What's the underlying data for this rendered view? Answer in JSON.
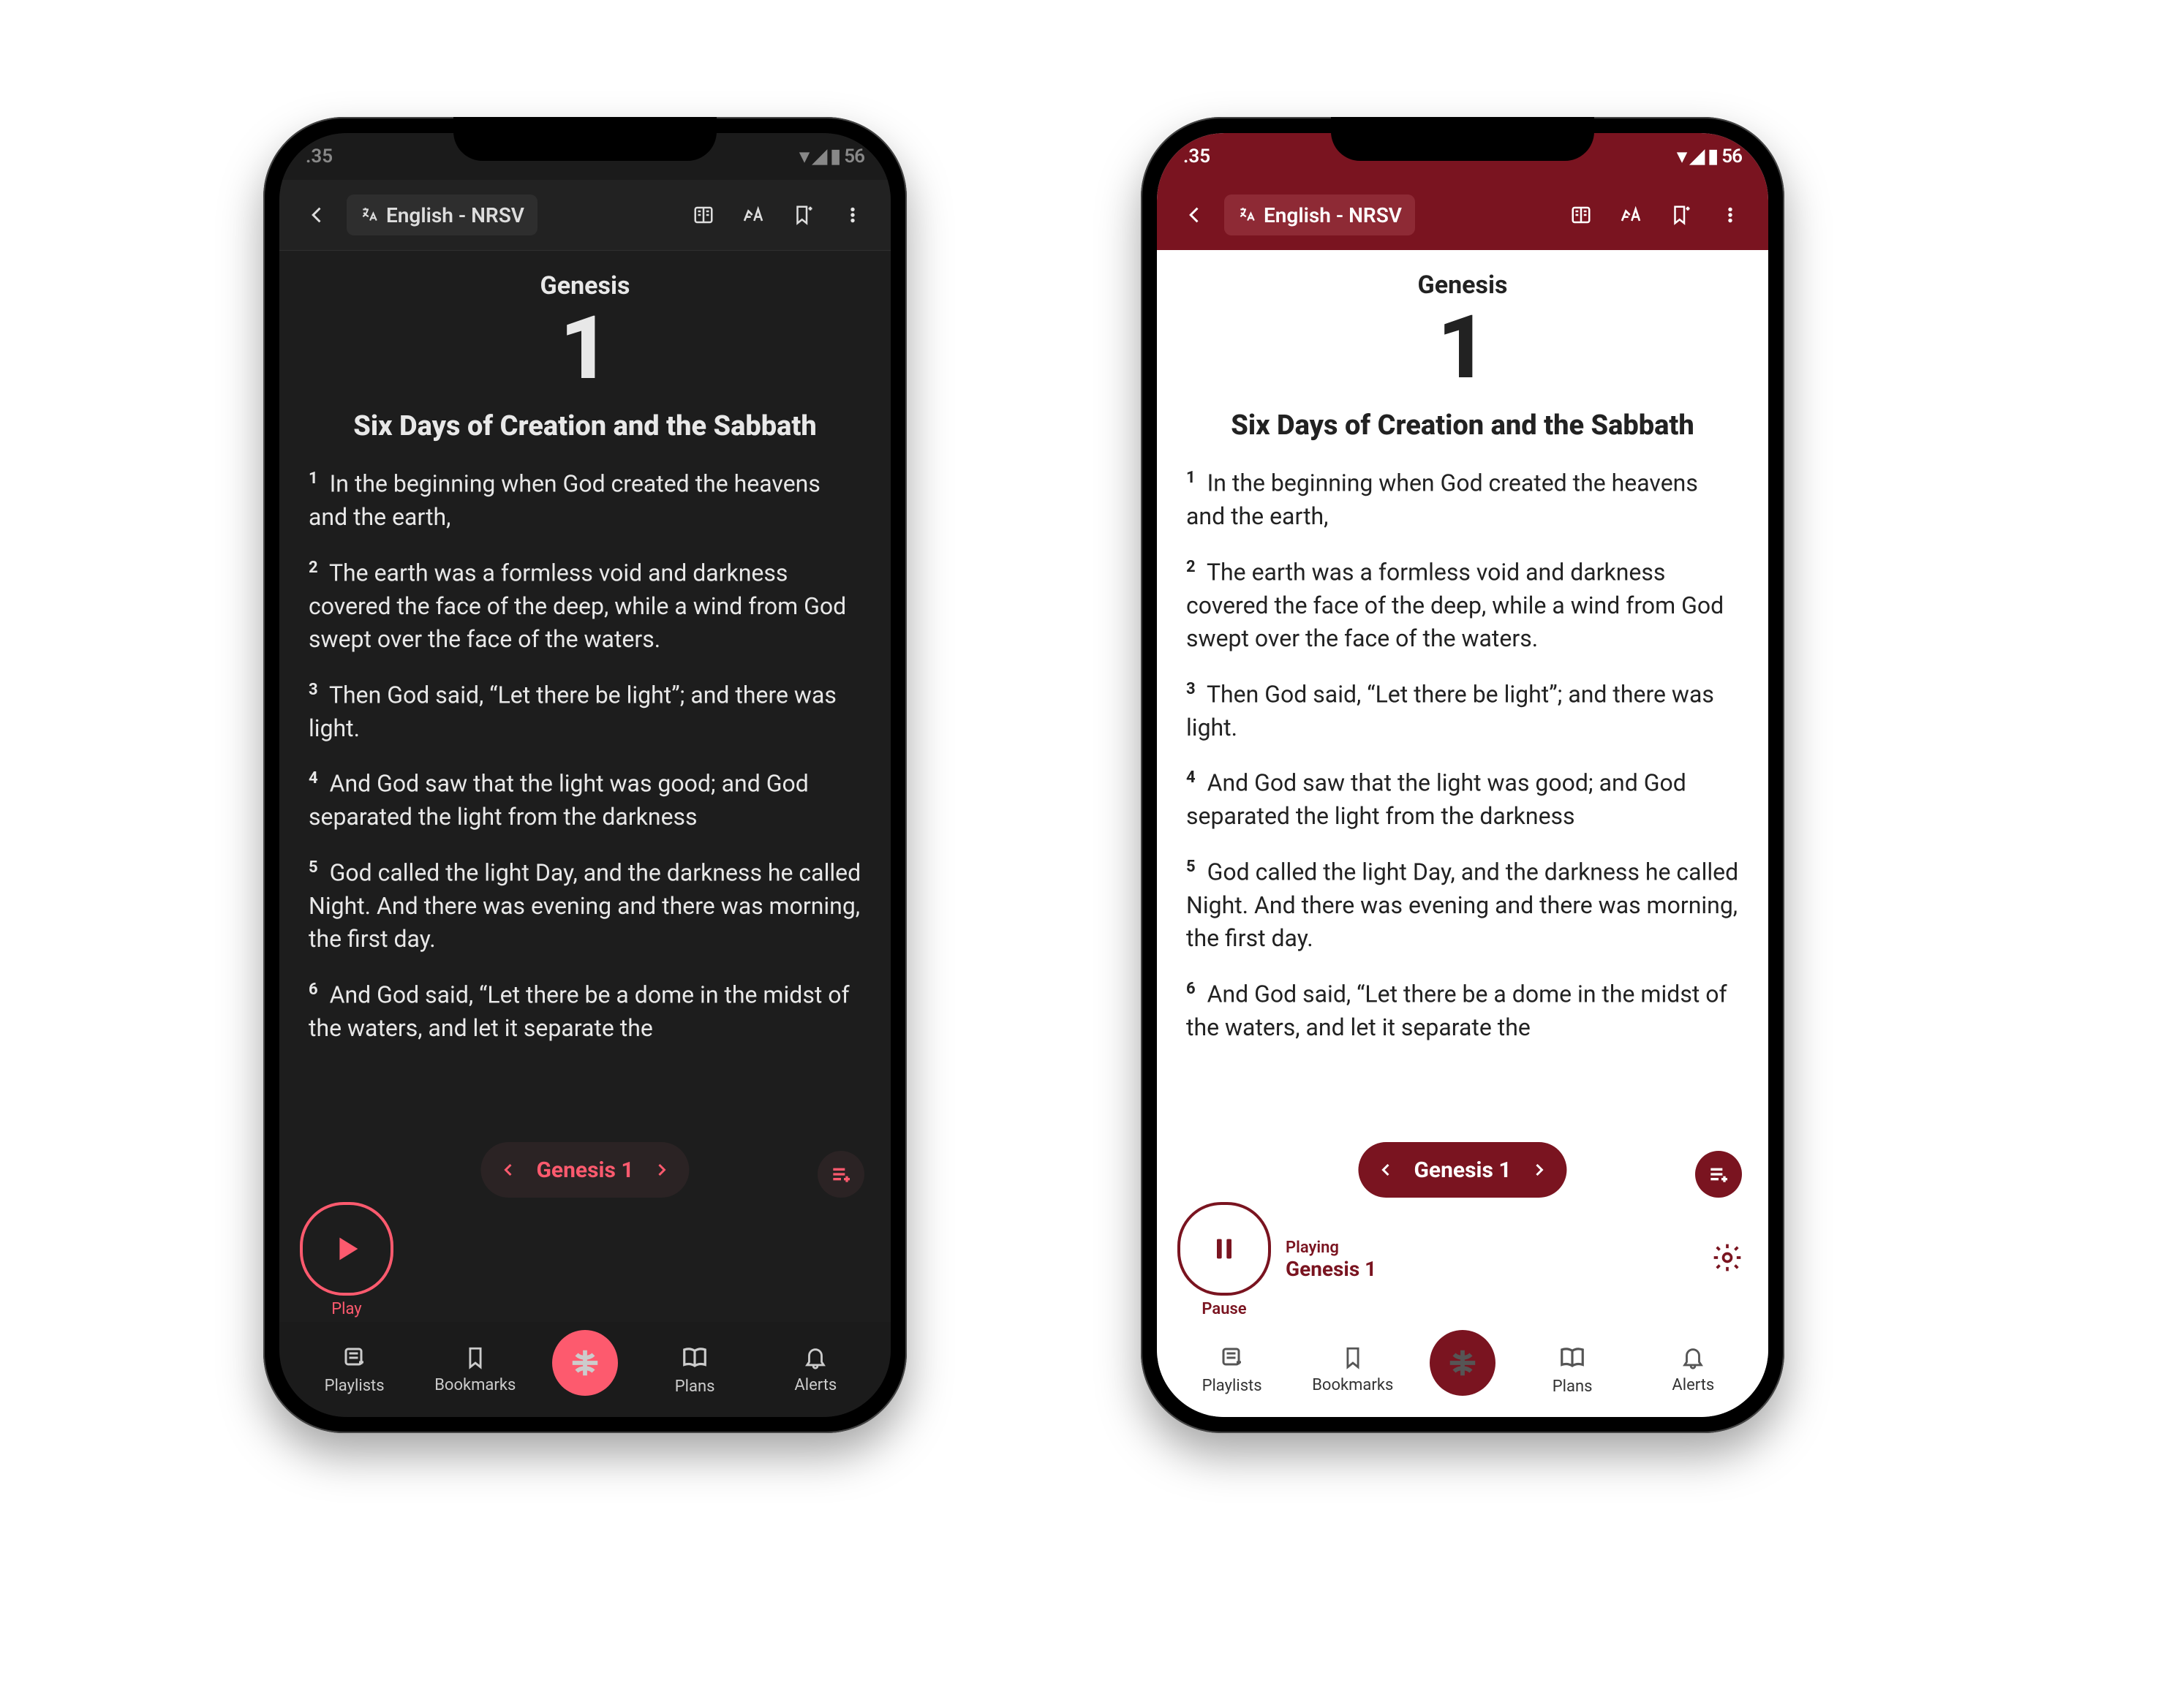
{
  "status": {
    "time": ".35",
    "indicators": "▾ ◢ ▮ 56"
  },
  "topbar": {
    "translation": "English - NRSV"
  },
  "content": {
    "book": "Genesis",
    "chapter": "1",
    "section": "Six Days of Creation and the Sabbath",
    "verses": [
      {
        "n": "1",
        "t": "In the beginning when God created the heavens and the earth,"
      },
      {
        "n": "2",
        "t": "The earth was a formless void and darkness covered the face of the deep, while a wind from God swept over the face of the waters."
      },
      {
        "n": "3",
        "t": "Then God said, “Let there be light”; and there was light."
      },
      {
        "n": "4",
        "t": "And God saw that the light was good; and God separated the light from the darkness"
      },
      {
        "n": "5",
        "t": "God called the light Day, and the darkness he called Night. And there was evening and there was morning, the first day."
      },
      {
        "n": "6",
        "t": "And God said, “Let there be a dome in the midst of the waters, and let it separate the"
      }
    ]
  },
  "chapter_pill": {
    "label": "Genesis 1"
  },
  "player_dark": {
    "action": "Play"
  },
  "player_light": {
    "action": "Pause",
    "status": "Playing",
    "track": "Genesis 1"
  },
  "tabs": {
    "playlists": "Playlists",
    "bookmarks": "Bookmarks",
    "plans": "Plans",
    "alerts": "Alerts"
  }
}
